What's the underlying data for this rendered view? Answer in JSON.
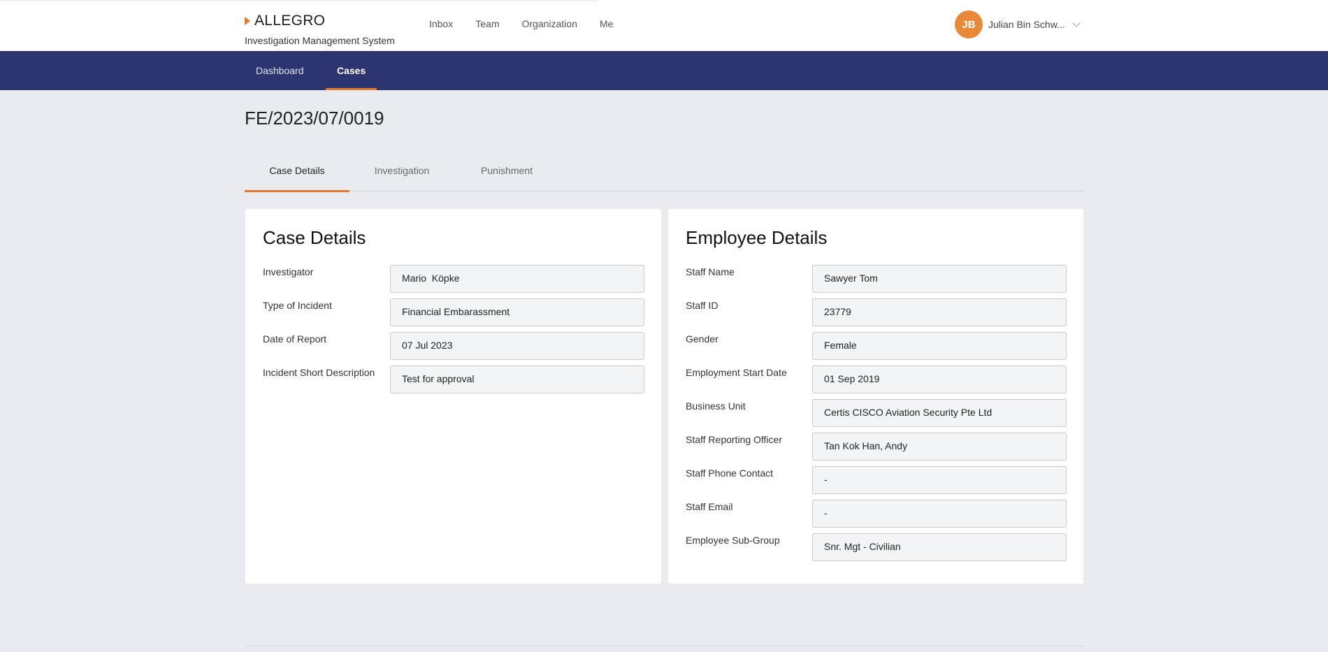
{
  "header": {
    "brand_name": "ALLEGRO",
    "brand_sub": "Investigation Management System",
    "nav": [
      "Inbox",
      "Team",
      "Organization",
      "Me"
    ],
    "user_initials": "JB",
    "user_name": "Julian Bin Schw..."
  },
  "navbar": {
    "tabs": [
      "Dashboard",
      "Cases"
    ],
    "active": "Cases"
  },
  "case": {
    "id": "FE/2023/07/0019",
    "tabs": [
      "Case Details",
      "Investigation",
      "Punishment"
    ],
    "active_tab": "Case Details"
  },
  "case_details": {
    "title": "Case Details",
    "fields": [
      {
        "label": "Investigator",
        "value": "Mario  Köpke"
      },
      {
        "label": "Type of Incident",
        "value": "Financial Embarassment"
      },
      {
        "label": "Date of Report",
        "value": "07 Jul 2023"
      },
      {
        "label": "Incident Short Description",
        "value": "Test for approval"
      }
    ]
  },
  "employee_details": {
    "title": "Employee Details",
    "fields": [
      {
        "label": "Staff Name",
        "value": "Sawyer Tom"
      },
      {
        "label": "Staff ID",
        "value": "23779"
      },
      {
        "label": "Gender",
        "value": "Female"
      },
      {
        "label": "Employment Start Date",
        "value": "01 Sep 2019"
      },
      {
        "label": "Business Unit",
        "value": "Certis CISCO Aviation Security Pte Ltd"
      },
      {
        "label": "Staff Reporting Officer",
        "value": "Tan Kok Han, Andy"
      },
      {
        "label": "Staff Phone Contact",
        "value": "-"
      },
      {
        "label": "Staff Email",
        "value": "-"
      },
      {
        "label": "Employee Sub-Group",
        "value": "Snr. Mgt - Civilian"
      }
    ]
  },
  "colors": {
    "accent": "#e8772e",
    "navbar": "#2c3570",
    "background": "#e9ebee"
  }
}
